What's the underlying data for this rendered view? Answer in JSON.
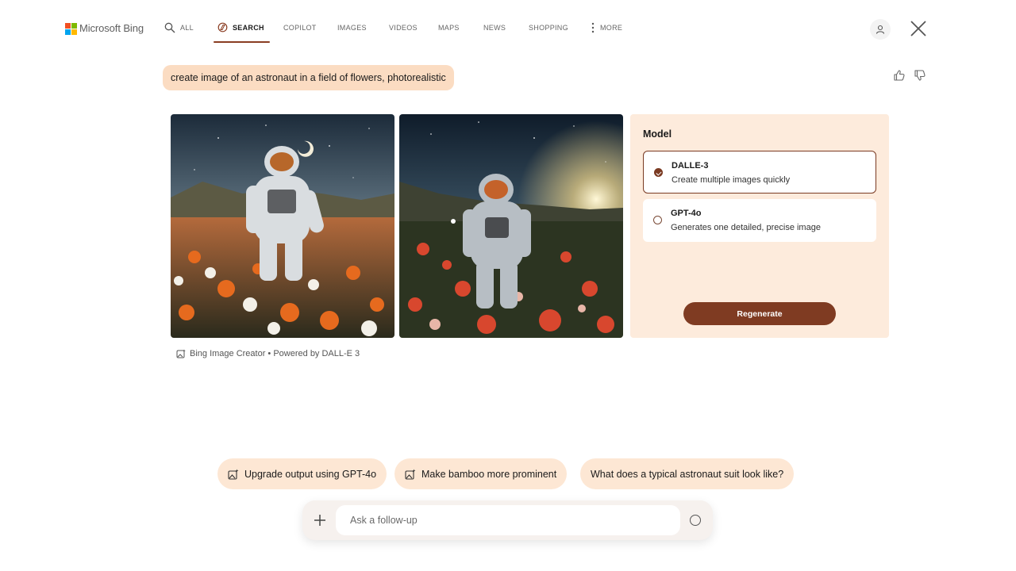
{
  "brand": {
    "name": "Microsoft Bing"
  },
  "nav": {
    "items": [
      {
        "label": "ALL",
        "icon": "search-icon"
      },
      {
        "label": "SEARCH",
        "icon": "copilot-icon",
        "active": true
      },
      {
        "label": "COPILOT"
      },
      {
        "label": "IMAGES"
      },
      {
        "label": "VIDEOS"
      },
      {
        "label": "MAPS"
      },
      {
        "label": "NEWS"
      },
      {
        "label": "SHOPPING"
      },
      {
        "label": "MORE",
        "icon": "more-vertical-icon"
      }
    ]
  },
  "prompt": {
    "text": "create image of an astronaut in a field of flowers, photorealistic"
  },
  "model_panel": {
    "title": "Model",
    "options": [
      {
        "name": "DALLE-3",
        "description": "Create multiple images quickly",
        "selected": true
      },
      {
        "name": "GPT-4o",
        "description": "Generates one detailed, precise image",
        "selected": false
      }
    ],
    "regenerate_label": "Regenerate"
  },
  "credit": {
    "text": "Bing Image Creator • Powered by DALL-E 3"
  },
  "suggestions": [
    {
      "label": "Upgrade output using GPT-4o",
      "icon": "image-sparkle-icon"
    },
    {
      "label": "Make bamboo more prominent",
      "icon": "image-sparkle-icon"
    },
    {
      "label": "What does a typical astronaut suit look like?"
    }
  ],
  "followup": {
    "placeholder": "Ask a follow-up"
  },
  "colors": {
    "accent": "#7f3b22",
    "chip": "#fde7d4",
    "panel": "#fdebdc",
    "prompt": "#fbdcc2"
  }
}
